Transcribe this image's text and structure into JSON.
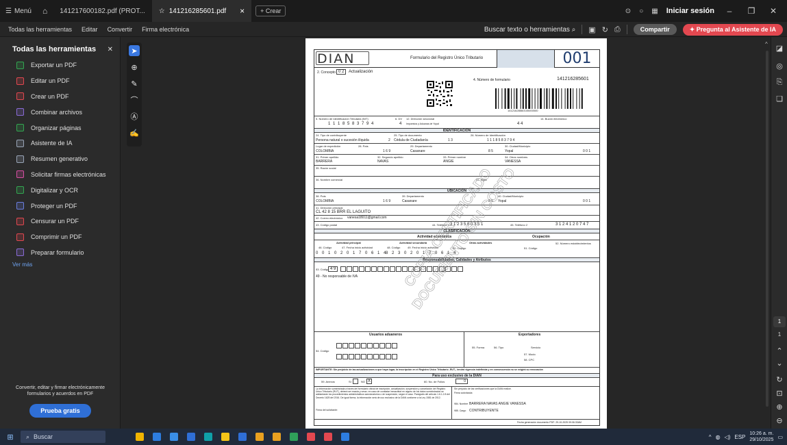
{
  "titlebar": {
    "menu_label": "Menú",
    "tabs": [
      {
        "label": "141217600182.pdf (PROT..."
      },
      {
        "label": "141216285601.pdf"
      }
    ],
    "new_tab_label": "+ Crear",
    "login_label": "Iniciar sesión"
  },
  "toolbar": {
    "menu": [
      "Todas las herramientas",
      "Editar",
      "Convertir",
      "Firma electrónica"
    ],
    "search_label": "Buscar texto o herramientas",
    "share_label": "Compartir",
    "ai_label": "Pregunta al Asistente de IA"
  },
  "sidebar": {
    "title": "Todas las herramientas",
    "tools": [
      {
        "label": "Exportar un PDF",
        "color": "#33a852",
        "icon": "export-pdf-icon"
      },
      {
        "label": "Editar un PDF",
        "color": "#e34850",
        "icon": "edit-pdf-icon"
      },
      {
        "label": "Crear un PDF",
        "color": "#e34850",
        "icon": "create-pdf-icon"
      },
      {
        "label": "Combinar archivos",
        "color": "#8b6cd8",
        "icon": "combine-files-icon"
      },
      {
        "label": "Organizar páginas",
        "color": "#33a852",
        "icon": "organize-pages-icon"
      },
      {
        "label": "Asistente de IA",
        "color": "#9aa6b8",
        "icon": "ai-assistant-icon"
      },
      {
        "label": "Resumen generativo",
        "color": "#9aa6b8",
        "icon": "generative-summary-icon"
      },
      {
        "label": "Solicitar firmas electrónicas",
        "color": "#d94fa5",
        "icon": "request-signatures-icon"
      },
      {
        "label": "Digitalizar y OCR",
        "color": "#33a852",
        "icon": "scan-ocr-icon"
      },
      {
        "label": "Proteger un PDF",
        "color": "#6b7fe0",
        "icon": "protect-pdf-icon"
      },
      {
        "label": "Censurar un PDF",
        "color": "#e34850",
        "icon": "redact-pdf-icon"
      },
      {
        "label": "Comprimir un PDF",
        "color": "#e34850",
        "icon": "compress-pdf-icon"
      },
      {
        "label": "Preparar formulario",
        "color": "#8b6cd8",
        "icon": "prepare-form-icon"
      }
    ],
    "see_more": "Ver más",
    "promo_text": "Convertir, editar y firmar electrónicamente formularios y acuerdos en PDF",
    "promo_button": "Prueba gratis"
  },
  "document": {
    "logo": "DIAN",
    "form_title": "Formulario del Registro Único Tributario",
    "form_code": "001",
    "concepto_label": "2. Concepto",
    "concepto_value": "0 2",
    "concepto_text": "Actualización",
    "form_number_label": "4. Número de formulario",
    "form_number": "141216285601",
    "barcode_text": "14121628560100000000",
    "nit_label": "5. Número de Identificación Tributaria (NIT)",
    "nit_value": "1 1 1 8 5 8 3 7 9 4",
    "dv_label": "6. DV",
    "dv_value": "4",
    "dir_seccional_label": "12. Dirección seccional",
    "dir_seccional_value": "Impuestos y Aduanas de Yopal",
    "buzon_label": "14. Buzón electrónico",
    "buzon_value": "4 4",
    "identificacion_band": "IDENTIFICACIÓN",
    "contribuyente_label": "24. Tipo de contribuyente",
    "contribuyente_value": "Persona natural o sucesión ilíquida",
    "contribuyente_code": "2",
    "tipo_doc_label": "25. Tipo de documento",
    "tipo_doc_value": "Cédula de Ciudadanía",
    "tipo_doc_code": "1 3",
    "num_id_label": "26. Número de Identificación",
    "num_id_value": "1 1 1 8 5 8 3 7 9 4",
    "expedicion_label": "Lugar de expedición",
    "pais_label": "28. País",
    "pais_value": "COLOMBIA",
    "pais_code": "1 6 9",
    "depto_label": "29. Departamento",
    "depto_value": "Casanare",
    "depto_code": "8 5",
    "ciudad_label": "30. Ciudad/Municipio",
    "ciudad_value": "Yopal",
    "ciudad_code": "0 0 1",
    "apellido1_label": "31. Primer apellido",
    "apellido1_value": "BARRERA",
    "apellido2_label": "32. Segundo apellido",
    "apellido2_value": "NAVAS",
    "nombre1_label": "33. Primer nombre",
    "nombre1_value": "ANGIE",
    "nombre2_label": "34. Otros nombres",
    "nombre2_value": "VANESSA",
    "razon_label": "35. Razón social",
    "nombre_com_label": "36. Nombre comercial",
    "sigla_label": "37. Sigla",
    "ubicacion_band": "UBICACIÓN",
    "u_pais_label": "38. País",
    "u_depto_label": "39. Departamento",
    "u_ciudad_label": "40. Ciudad/Municipio",
    "direccion_label": "41. Dirección principal",
    "direccion_value": "CL 42 8 15 BRR EL LAGUITO",
    "correo_label": "42. Correo electrónico",
    "correo_value": "vanesa18011@gmail.com",
    "postal_label": "43. Código postal",
    "tel1_label": "44. Teléfono 1",
    "tel1_value": "3 1 2 3 5 6 0 3 5 1",
    "tel2_label": "45. Teléfono 2",
    "tel2_value": "3 1 2 4 1 2 0 7 4 7",
    "clasificacion_band": "CLASIFICACIÓN",
    "actividad_header": "Actividad económica",
    "ocupacion_header": "Ocupación",
    "principal_label": "Actividad principal",
    "secundaria_label": "Actividad secundaria",
    "otras_label": "Otras actividades",
    "act_code_label": "46. Código",
    "act_date_label": "47. Fecha inicio actividad",
    "sec_code_label": "48. Código",
    "sec_date_label": "49. Fecha inicio actividad",
    "otras_code_label": "50. Código",
    "ocup_code_label": "51. Código",
    "num_est_label": "52. Número establecimientos",
    "act_principal_value": "0 0 1 0 2 0 1 7 0 6 1 4",
    "act_secundaria_value": "8 2 3 0 2 0 1 7 0 6 1 4",
    "resp_header": "Responsabilidades, Calidades y Atributos",
    "resp_code_label": "53. Código",
    "resp_code_value": "4 9",
    "resp_text": "49 - No responsable de IVA",
    "aduaneros_header": "Usuarios aduaneros",
    "export_header": "Exportadores",
    "aduan_code_label": "54. Código",
    "forma_label": "55. Forma",
    "tipo_label": "56. Tipo",
    "servicio_label": "Servicio",
    "modo_label": "57. Modo",
    "cpc_label": "58. CPC",
    "important_text": "IMPORTANTE: Sin perjuicio de las actualizaciones a que haya lugar, la inscripción en el Registro Único Tributario -RUT-, tendrá vigencia indefinida y en consecuencia no se exigirá su renovación",
    "dian_use_band": "Para uso exclusivo de la DIAN",
    "anexos_label": "59. Anexos",
    "si_label": "SI",
    "no_label": "NO",
    "no_mark": "X",
    "folios_label": "60. No. de Folios",
    "folios_value": "0",
    "legal_text": "La información suministrada a través del formulario oficial de inscripción, actualización, suspensión y cancelación del Registro Único Tributario (RUT), deberá ser exacta y veraz; en caso de constatar inexactitud en alguno de los datos suministrados se adelantarán los procedimientos administrativos sancionatorios o de suspensión, según el caso. Parágrafo del artículo 1.6.1.2.8 del Decreto 1625 del 2016. De igual forma, la información será de uso exclusivo de la DIAN conforme a la Ley 1581 de 2012.",
    "firma_label": "Firma del solicitante:",
    "verif_text": "Sin perjuicio de las verificaciones que la DIAN realice.",
    "firma_aut_label": "Firma autorizada:",
    "nombre_label": "984. Nombre",
    "nombre_value": "BARRERA NAVAS ANGIE VANESSA",
    "cargo_label": "985. Cargo",
    "cargo_value": "CONTRIBUYENTE",
    "fecha_gen": "Fecha generación documento PDF: 29-10-2025 09:06:33AM",
    "watermark_lines": [
      "COPIA CERTIFICADO",
      "DOCUMENTO SIN COSTO"
    ]
  },
  "rightrail": {
    "page_current": "1",
    "page_total": "1"
  },
  "taskbar": {
    "search_placeholder": "Buscar",
    "lang": "ESP",
    "time": "10:26 a. m.",
    "date": "29/10/2025",
    "app_colors": [
      "#f0b400",
      "#2d7de0",
      "#3a8ee6",
      "#2f6fd6",
      "#0fa0a8",
      "#f5c518",
      "#2f6fd6",
      "#e8a020",
      "#e8a020",
      "#2fa05a",
      "#e34850",
      "#e34850",
      "#2d7de0"
    ]
  }
}
